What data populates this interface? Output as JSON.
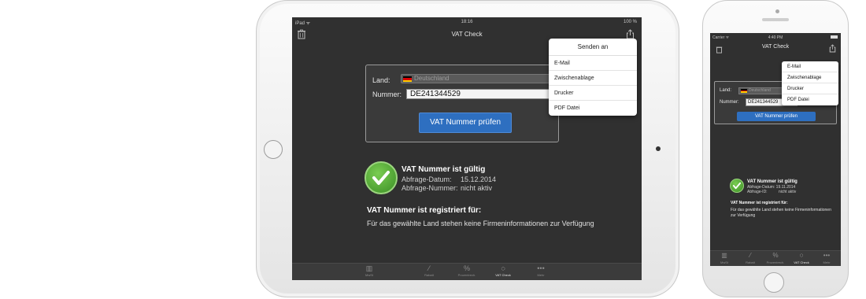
{
  "ipad": {
    "status": {
      "device": "iPad ᯤ",
      "time": "18:16",
      "battery": "100 %"
    },
    "nav": {
      "title": "VAT Check",
      "trash_icon": "trash-icon",
      "share_icon": "share-icon"
    },
    "form": {
      "land_label": "Land:",
      "country_value": "Deutschland",
      "nummer_label": "Nummer:",
      "vat_number": "DE241344529",
      "check_button": "VAT Nummer prüfen"
    },
    "result": {
      "valid_title": "VAT Nummer ist gültig",
      "date_label": "Abfrage-Datum:",
      "date_value": "15.12.2014",
      "query_label": "Abfrage-Nummer:",
      "query_value": "nicht aktiv",
      "registered_title": "VAT Nummer ist registriert für:",
      "registered_text": "Für das gewählte Land stehen keine Firmeninformationen zur Verfügung"
    },
    "popover": {
      "header": "Senden an",
      "items": [
        "E-Mail",
        "Zwischenablage",
        "Drucker",
        "PDF Datei"
      ]
    },
    "tabs": [
      {
        "icon": "▥",
        "label": "MwSt"
      },
      {
        "icon": "⁄",
        "label": "Rabatt"
      },
      {
        "icon": "%",
        "label": "Prozentrech."
      },
      {
        "icon": "◌",
        "label": "VAT Check"
      },
      {
        "icon": "•••",
        "label": "Mehr"
      }
    ]
  },
  "iphone": {
    "status": {
      "carrier": "Carrier ᯤ",
      "time": "4:40 PM"
    },
    "nav": {
      "title": "VAT Check"
    },
    "form": {
      "land_label": "Land:",
      "country_value": "Deutschland",
      "nummer_label": "Nummer:",
      "vat_number": "DE241344529",
      "check_button": "VAT Nummer prüfen"
    },
    "popover": {
      "items": [
        "E-Mail",
        "Zwischenablage",
        "Drucker",
        "PDF Datei"
      ]
    },
    "result": {
      "valid_title": "VAT Nummer ist gültig",
      "date_label": "Abfrage-Datum: 19.11.2014",
      "query_label": "Abfrage-ID:",
      "query_value": "nicht aktiv",
      "registered_title": "VAT Nummer ist registriert für:",
      "registered_text": "Für das gewählte Land stehen keine Firmeninformationen zur Verfügung"
    },
    "tabs": [
      {
        "icon": "▥",
        "label": "MwSt"
      },
      {
        "icon": "⁄",
        "label": "Rabatt"
      },
      {
        "icon": "%",
        "label": "Prozentrech."
      },
      {
        "icon": "◌",
        "label": "VAT Check"
      },
      {
        "icon": "•••",
        "label": "Mehr"
      }
    ]
  },
  "colors": {
    "accent": "#2e6fc0",
    "screen_bg": "#303030",
    "success": "#4aa52e"
  }
}
